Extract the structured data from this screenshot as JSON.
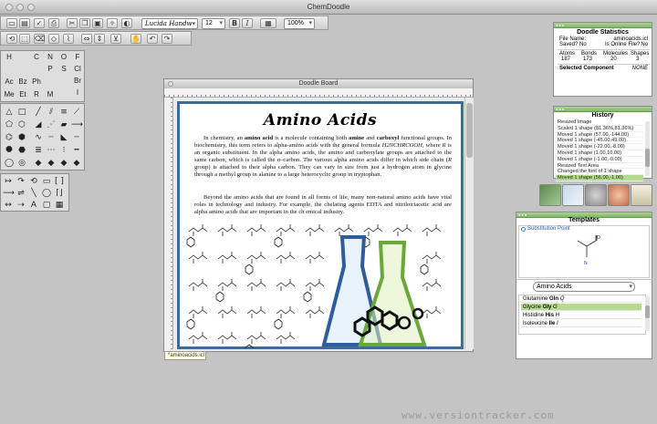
{
  "app": {
    "title": "ChemDoodle"
  },
  "toolbar": {
    "font_name": "Lucida Handw",
    "font_size": "12",
    "bold_label": "B",
    "italic_label": "I",
    "zoom": "100%"
  },
  "elements": {
    "row1": [
      "H",
      "",
      "C",
      "N",
      "O",
      "F"
    ],
    "row2": [
      "",
      "",
      "",
      "P",
      "S",
      "Cl"
    ],
    "row3": [
      "",
      "",
      "",
      "",
      "",
      "Br"
    ],
    "row4": [
      "Ac",
      "Bz",
      "Ph",
      "",
      "",
      "I"
    ],
    "row5": [
      "Me",
      "Et",
      "R",
      "M",
      "",
      ""
    ]
  },
  "doodle_board": {
    "title": "Doodle Board",
    "heading": "Amino Acids",
    "p1": {
      "a": "In chemistry, an ",
      "b": "amino acid",
      "c": " is a molecule containing both ",
      "d": "amine",
      "e": " and ",
      "f": "carboxyl",
      "g": " functional groups. In biochemistry, this term refers to alpha-amino acids with the general formula ",
      "h": "H2NCHRCOOH",
      "i": ", where ",
      "j": "R",
      "k": " is an organic substituent. In the alpha amino acids, the amino and carboxylate groups are attached to the same carbon, which is called the α–carbon. The various alpha amino acids differ in which side chain (",
      "l": "R",
      "m": " group) is attached to their alpha carbon. They can vary in size from just a hydrogen atom in glycine through a methyl group in alanine to a large heterocyclic group in tryptophan."
    },
    "p2": "Beyond the amino acids that are found in all forms of life, many non-natural amino acids have vital roles in technology and industry. For example, the chelating agents EDTA and nitrilotriacetic acid are alpha amino acids that are important in the ch emical industry.",
    "tab_label": "*aminoacids.icl"
  },
  "stats": {
    "title": "Doodle Statistics",
    "file_name_label": "File Name:",
    "file_name": "aminoacids.icl",
    "saved_label": "Saved?",
    "saved_value": "No",
    "online_label": "Is Online File?",
    "online_value": "No",
    "headers": [
      "Atoms",
      "Bonds",
      "Molecules",
      "Shapes"
    ],
    "values": [
      "187",
      "173",
      "20",
      "3"
    ],
    "selected_label": "Selected Component",
    "selected_value": "NONE"
  },
  "history": {
    "title": "History",
    "items": [
      "Resized Image",
      "Scaled 1 shape (81.36%,81.36%)",
      "Moved 1 shape (57.00,-144.00)",
      "Moved 1 shape (-45.00,49.00)",
      "Moved 1 shape (-22.00,-8.00)",
      "Moved 1 shape (1.00,10.00)",
      "Moved 1 shape (-1.00,-0.00)",
      "Resized Text Area",
      "Changed the font of 1 shape",
      "Moved 1 shape (56.00,-1.00)"
    ],
    "active_index": 9
  },
  "templates": {
    "title": "Templates",
    "substitution_label": "Substitution Point",
    "category": "Amino Acids",
    "list": [
      {
        "name": "Glutamine",
        "code": "Gln",
        "letter": "Q"
      },
      {
        "name": "Glycine",
        "code": "Gly",
        "letter": "G"
      },
      {
        "name": "Histidine",
        "code": "His",
        "letter": "H"
      },
      {
        "name": "Isoleucine",
        "code": "Ile",
        "letter": "I"
      }
    ],
    "selected_index": 1
  },
  "footer": {
    "text": "www.versiontracker.com"
  },
  "colors": {
    "accent_green": "#7fb866",
    "selection_green": "#b5dc8e",
    "frame_blue": "#3d6c9a",
    "flask_blue": "#2e5d9c",
    "flask_green": "#6aa83c"
  }
}
